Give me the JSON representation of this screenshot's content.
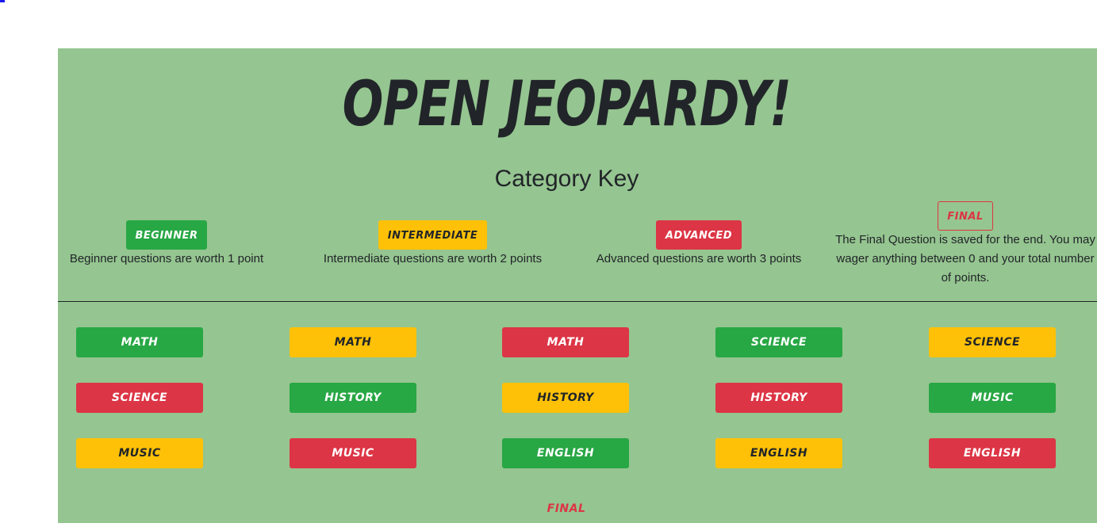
{
  "title": "Open Jeopardy!",
  "subtitle": "Category Key",
  "colors": {
    "board_bg": "#95c590",
    "green": "#28a745",
    "yellow": "#ffc107",
    "red": "#dc3545"
  },
  "key": [
    {
      "badge": "Beginner",
      "desc": "Beginner questions are worth 1 point",
      "color": "green"
    },
    {
      "badge": "Intermediate",
      "desc": "Intermediate questions are worth 2 points",
      "color": "yellow"
    },
    {
      "badge": "Advanced",
      "desc": "Advanced questions are worth 3 points",
      "color": "red"
    },
    {
      "badge": "Final",
      "desc": "The Final Question is saved for the end. You may wager anything between 0 and your total number of points.",
      "color": "outline-red"
    }
  ],
  "categories": [
    {
      "label": "Math",
      "color": "green"
    },
    {
      "label": "Math",
      "color": "yellow"
    },
    {
      "label": "Math",
      "color": "red"
    },
    {
      "label": "Science",
      "color": "green"
    },
    {
      "label": "Science",
      "color": "yellow"
    },
    {
      "label": "Science",
      "color": "red"
    },
    {
      "label": "History",
      "color": "green"
    },
    {
      "label": "History",
      "color": "yellow"
    },
    {
      "label": "History",
      "color": "red"
    },
    {
      "label": "Music",
      "color": "green"
    },
    {
      "label": "Music",
      "color": "yellow"
    },
    {
      "label": "Music",
      "color": "red"
    },
    {
      "label": "English",
      "color": "green"
    },
    {
      "label": "English",
      "color": "yellow"
    },
    {
      "label": "English",
      "color": "red"
    }
  ],
  "final_button": {
    "label": "Final",
    "color": "outline-red"
  }
}
